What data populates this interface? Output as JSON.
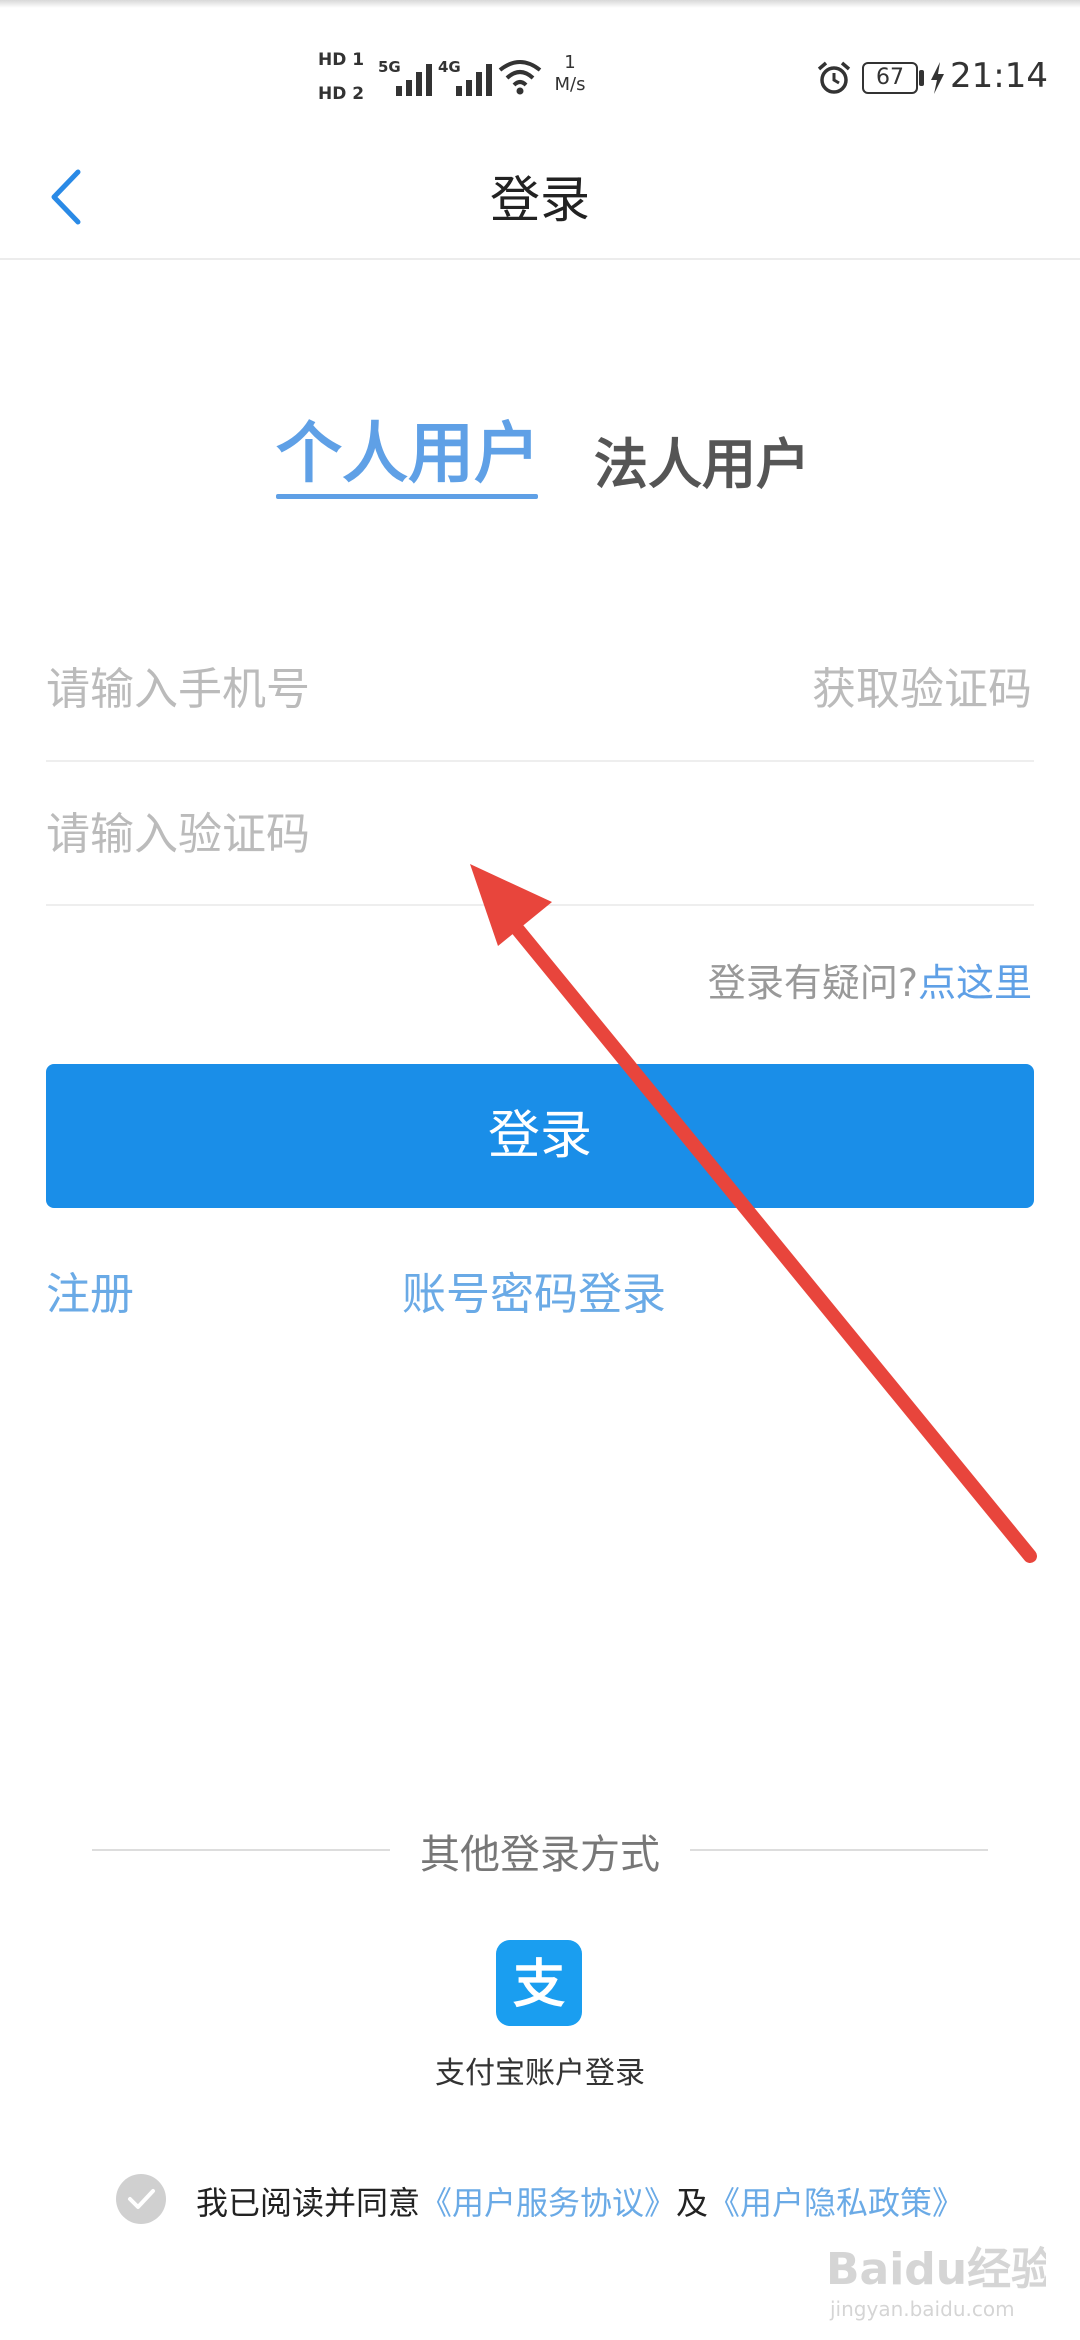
{
  "status_bar": {
    "hd1": "HD 1",
    "hd2": "HD 2",
    "net1": "5G",
    "net2": "4G",
    "speed_value": "1",
    "speed_unit": "M/s",
    "battery": "67",
    "time": "21:14",
    "icons": [
      "signal-icon",
      "wifi-icon",
      "alarm-icon",
      "battery-icon",
      "charging-bolt-icon"
    ]
  },
  "header": {
    "title": "登录",
    "back_icon": "chevron-left-icon"
  },
  "tabs": [
    {
      "label": "个人用户",
      "active": true
    },
    {
      "label": "法人用户",
      "active": false
    }
  ],
  "form": {
    "phone_placeholder": "请输入手机号",
    "get_code_label": "获取验证码",
    "code_placeholder": "请输入验证码",
    "help_text": "登录有疑问?",
    "help_link": "点这里",
    "login_button": "登录",
    "register_link": "注册",
    "password_login_link": "账号密码登录"
  },
  "other_login": {
    "title": "其他登录方式",
    "alipay_glyph": "支",
    "alipay_label": "支付宝账户登录",
    "alipay_color": "#1a9ef0"
  },
  "agreement": {
    "checked": false,
    "text": "我已阅读并同意",
    "terms_link": "《用户服务协议》",
    "conjunction": "及",
    "privacy_link": "《用户隐私政策》"
  },
  "colors": {
    "accent": "#1a8ee8",
    "link": "#5fa0e6",
    "annotation_arrow": "#e8453c"
  },
  "watermark": {
    "text": "Baidu经验",
    "subtext": "jingyan.baidu.com"
  }
}
